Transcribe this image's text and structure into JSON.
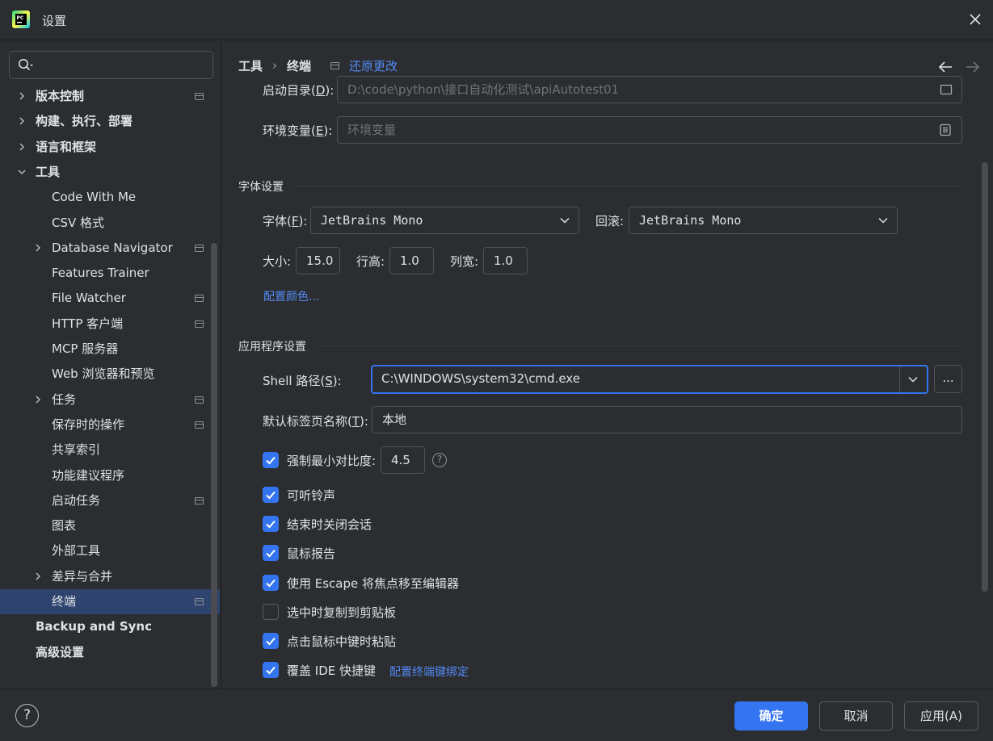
{
  "window": {
    "title": "设置"
  },
  "search": {
    "placeholder": ""
  },
  "sidebar": {
    "items": [
      {
        "label": "版本控制",
        "level": 0,
        "bold": true,
        "arrow": true,
        "pin": true
      },
      {
        "label": "构建、执行、部署",
        "level": 0,
        "bold": true,
        "arrow": true,
        "pin": false
      },
      {
        "label": "语言和框架",
        "level": 0,
        "bold": true,
        "arrow": true,
        "pin": false
      },
      {
        "label": "工具",
        "level": 0,
        "bold": true,
        "arrow": true,
        "expanded": true,
        "pin": false
      },
      {
        "label": "Code With Me",
        "level": 1,
        "pin": false
      },
      {
        "label": "CSV 格式",
        "level": 1,
        "pin": false
      },
      {
        "label": "Database Navigator",
        "level": 1,
        "arrow": true,
        "pin": true
      },
      {
        "label": "Features Trainer",
        "level": 1,
        "pin": false
      },
      {
        "label": "File Watcher",
        "level": 1,
        "pin": true
      },
      {
        "label": "HTTP 客户端",
        "level": 1,
        "pin": true
      },
      {
        "label": "MCP 服务器",
        "level": 1,
        "pin": false
      },
      {
        "label": "Web 浏览器和预览",
        "level": 1,
        "pin": false
      },
      {
        "label": "任务",
        "level": 1,
        "arrow": true,
        "pin": true
      },
      {
        "label": "保存时的操作",
        "level": 1,
        "pin": true
      },
      {
        "label": "共享索引",
        "level": 1,
        "pin": false
      },
      {
        "label": "功能建议程序",
        "level": 1,
        "pin": false
      },
      {
        "label": "启动任务",
        "level": 1,
        "pin": true
      },
      {
        "label": "图表",
        "level": 1,
        "pin": false
      },
      {
        "label": "外部工具",
        "level": 1,
        "pin": false
      },
      {
        "label": "差异与合并",
        "level": 1,
        "arrow": true,
        "pin": false
      },
      {
        "label": "终端",
        "level": 1,
        "selected": true,
        "pin": true
      },
      {
        "label": "Backup and Sync",
        "level": 0,
        "bold": true,
        "pin": false
      },
      {
        "label": "高级设置",
        "level": 0,
        "bold": true,
        "pin": false
      }
    ]
  },
  "breadcrumb": {
    "parent": "工具",
    "sep": "›",
    "current": "终端",
    "reset": "还原更改"
  },
  "project": {
    "start_dir_label_pre": "启动目录(",
    "start_dir_key": "D",
    "start_dir_label_post": "):",
    "start_dir_value": "D:\\code\\python\\接口自动化测试\\apiAutotest01",
    "env_label_pre": "环境变量(",
    "env_key": "E",
    "env_label_post": "):",
    "env_placeholder": "环境变量"
  },
  "font_settings": {
    "title": "字体设置",
    "font_label_pre": "字体(",
    "font_key": "F",
    "font_label_post": "):",
    "font_value": "JetBrains Mono",
    "fallback_label": "回滚:",
    "fallback_value": "JetBrains Mono",
    "size_label": "大小:",
    "size_value": "15.0",
    "line_height_label": "行高:",
    "line_height_value": "1.0",
    "col_width_label": "列宽:",
    "col_width_value": "1.0",
    "config_colors": "配置颜色..."
  },
  "app_settings": {
    "title": "应用程序设置",
    "shell_label_pre": "Shell 路径(",
    "shell_key": "S",
    "shell_label_post": "):",
    "shell_value": "C:\\WINDOWS\\system32\\cmd.exe",
    "browse": "...",
    "tab_label_pre": "默认标签页名称(",
    "tab_key": "T",
    "tab_label_post": "):",
    "tab_value": "本地",
    "contrast_label": "强制最小对比度:",
    "contrast_value": "4.5",
    "help_mark": "?",
    "checkboxes": [
      {
        "label": "可听铃声",
        "checked": true
      },
      {
        "label": "结束时关闭会话",
        "checked": true
      },
      {
        "label": "鼠标报告",
        "checked": true
      },
      {
        "label": "使用 Escape 将焦点移至编辑器",
        "checked": true
      },
      {
        "label": "选中时复制到剪贴板",
        "checked": false
      },
      {
        "label": "点击鼠标中键时粘贴",
        "checked": true
      },
      {
        "label": "覆盖 IDE 快捷键",
        "checked": true
      }
    ],
    "override_link": "配置终端键绑定"
  },
  "footer": {
    "help": "?",
    "ok": "确定",
    "cancel": "取消",
    "apply": "应用(A)"
  },
  "colors": {
    "accent": "#3574f0",
    "link": "#548af7",
    "selected_row": "#2e436e",
    "background": "#2b2d30"
  }
}
